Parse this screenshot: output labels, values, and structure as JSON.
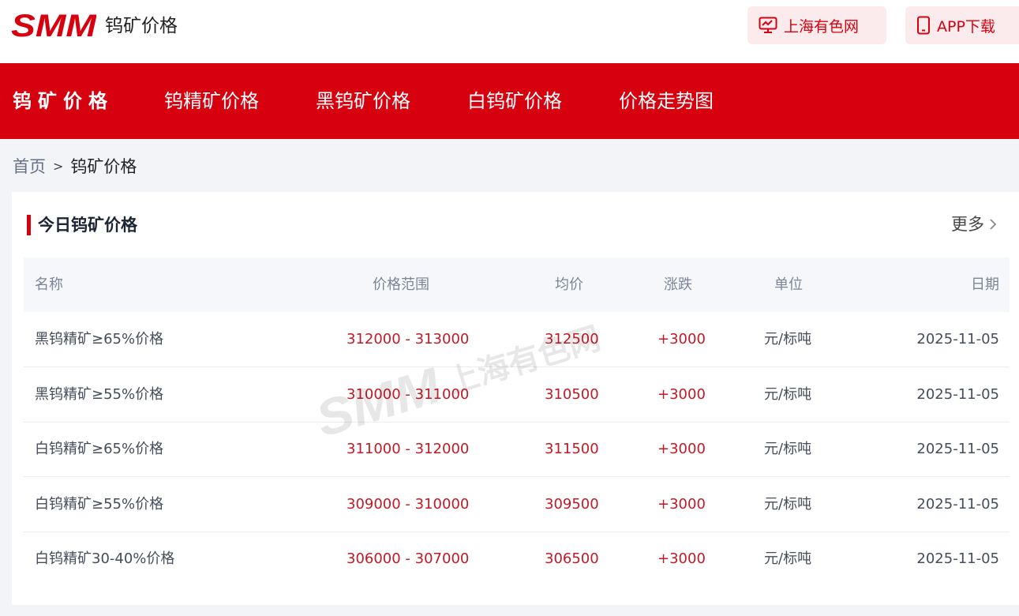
{
  "header": {
    "logo_text": "SMM",
    "title": "钨矿价格",
    "site_button": "上海有色网",
    "app_button": "APP下载",
    "brand_color": "#d7000f"
  },
  "nav": {
    "items": [
      {
        "label": "钨矿价格",
        "active": true
      },
      {
        "label": "钨精矿价格"
      },
      {
        "label": "黑钨矿价格"
      },
      {
        "label": "白钨矿价格"
      },
      {
        "label": "价格走势图"
      }
    ]
  },
  "breadcrumb": {
    "home": "首页",
    "separator": ">",
    "current": "钨矿价格"
  },
  "section": {
    "title": "今日钨矿价格",
    "more": "更多"
  },
  "table": {
    "headers": [
      "名称",
      "价格范围",
      "均价",
      "涨跌",
      "单位",
      "日期"
    ],
    "rows": [
      {
        "name": "黑钨精矿≥65%价格",
        "range": "312000 - 313000",
        "avg": "312500",
        "change": "+3000",
        "unit": "元/标吨",
        "date": "2025-11-05"
      },
      {
        "name": "黑钨精矿≥55%价格",
        "range": "310000 - 311000",
        "avg": "310500",
        "change": "+3000",
        "unit": "元/标吨",
        "date": "2025-11-05"
      },
      {
        "name": "白钨精矿≥65%价格",
        "range": "311000 - 312000",
        "avg": "311500",
        "change": "+3000",
        "unit": "元/标吨",
        "date": "2025-11-05"
      },
      {
        "name": "白钨精矿≥55%价格",
        "range": "309000 - 310000",
        "avg": "309500",
        "change": "+3000",
        "unit": "元/标吨",
        "date": "2025-11-05"
      },
      {
        "name": "白钨精矿30-40%价格",
        "range": "306000 - 307000",
        "avg": "306500",
        "change": "+3000",
        "unit": "元/标吨",
        "date": "2025-11-05"
      }
    ]
  },
  "watermark": {
    "logo_text": "SMM",
    "text": "上海有色网"
  }
}
